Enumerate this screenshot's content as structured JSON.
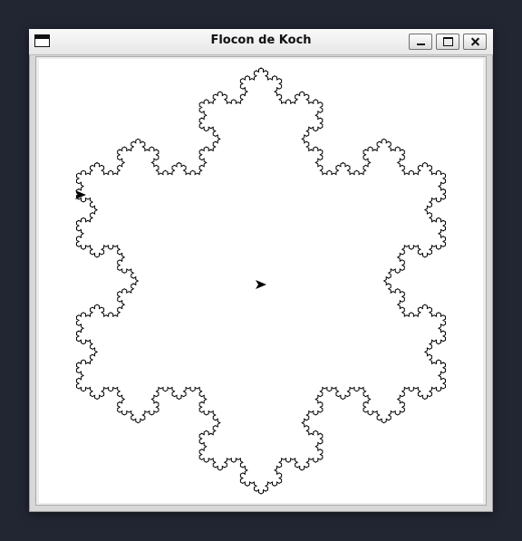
{
  "window": {
    "title": "Flocon de Koch"
  },
  "icons": {
    "system_menu": "window-menu-icon",
    "minimize": "minimize-icon",
    "maximize": "maximize-icon",
    "close": "close-icon",
    "turtle": "turtle-cursor-icon"
  },
  "colors": {
    "background": "#222633",
    "titlebar": "#ececec",
    "canvas": "#ffffff",
    "stroke": "#000000"
  }
}
